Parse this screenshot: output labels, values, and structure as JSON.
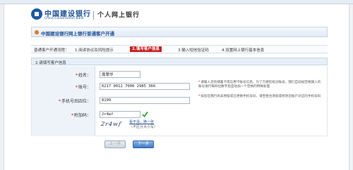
{
  "browser": {
    "bookmarks": [
      "",
      "",
      "",
      "",
      "",
      "",
      ""
    ]
  },
  "header": {
    "bank_name_cn": "中国建设银行",
    "bank_name_en": "China Construction Bank",
    "section": "个人网上银行"
  },
  "page": {
    "title": "中国建设银行网上银行普通客户开通",
    "process_label": "普通客户开通流程：",
    "steps": [
      {
        "label": "1.阅读协议及风险提示",
        "active": false
      },
      {
        "label": "2.填写客户信息",
        "active": true
      },
      {
        "label": "3.输入短信验证码",
        "active": false
      },
      {
        "label": "4.设置网上银行基本信息",
        "active": false
      }
    ],
    "section_title": "2.请填写客户信息"
  },
  "form": {
    "name": {
      "label": "姓名：",
      "value": "周翠华"
    },
    "account": {
      "label": "账号：",
      "value": "6217 0012 7000 2985 366",
      "hint": "请输入您的储蓄卡或信用卡账号信息。为了方便您核对账号，我们自动加空格输入的账号进行每四位数字后自动加一个空格的特殊处理"
    },
    "phone_last4": {
      "label": "手机号后四位：",
      "value": "8199",
      "hint": "如您在我行尚未预留或已更换手机号码，请至柜台添加或修改您账户对应的手机号码"
    },
    "captcha_input": {
      "label": "附加码：",
      "value": "2r4wf"
    },
    "captcha_image_text": "2r4wf",
    "refresh_link": "看不清，换一张",
    "case_note": "（不区分大小写）"
  },
  "buttons": {
    "prev": "上一步",
    "next": "下一步"
  },
  "colors": {
    "brand_blue": "#1c4f96",
    "active_step_red": "#c81f1f",
    "required_star_red": "#d00000",
    "check_green": "#2fa52f"
  }
}
